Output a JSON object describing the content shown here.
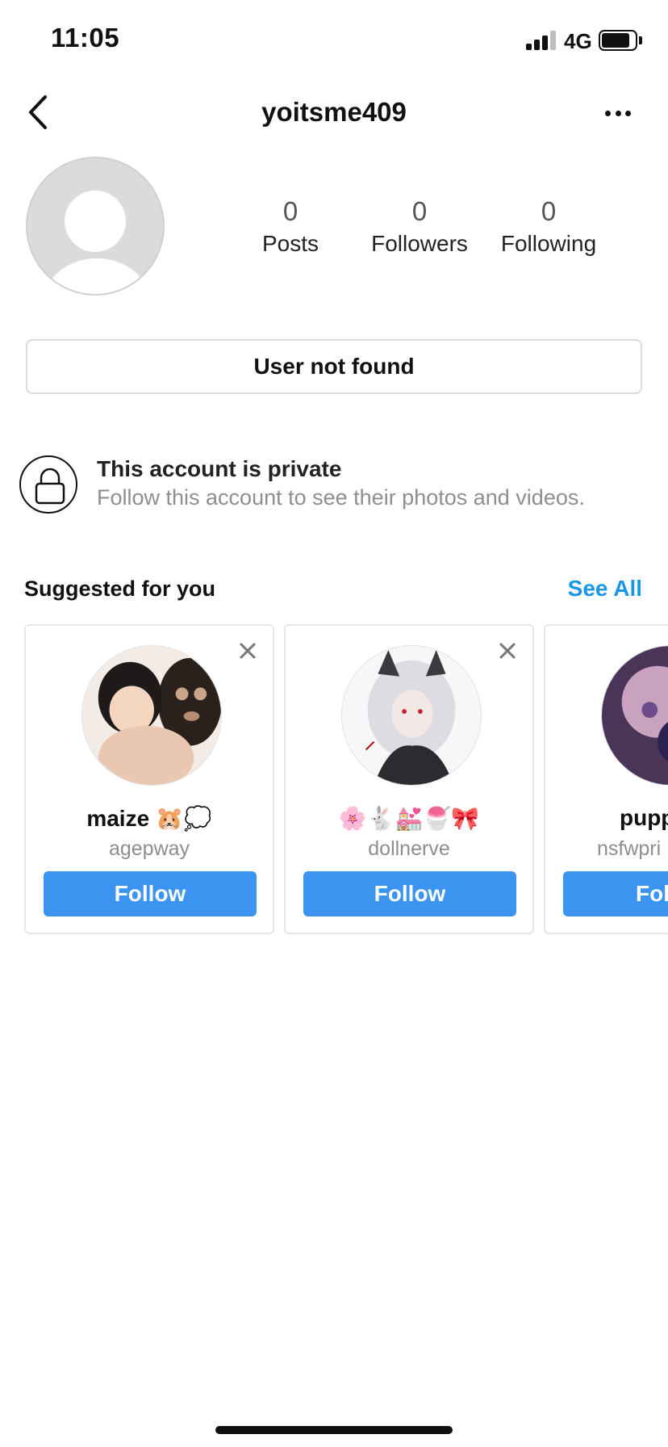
{
  "status_bar": {
    "time": "11:05",
    "network": "4G"
  },
  "header": {
    "username": "yoitsme409"
  },
  "profile": {
    "stats": [
      {
        "count": "0",
        "label": "Posts"
      },
      {
        "count": "0",
        "label": "Followers"
      },
      {
        "count": "0",
        "label": "Following"
      }
    ],
    "not_found_label": "User not found"
  },
  "private_notice": {
    "title": "This account is private",
    "subtitle": "Follow this account to see their photos and videos."
  },
  "suggested": {
    "title": "Suggested for you",
    "see_all_label": "See All",
    "cards": [
      {
        "name": "maize 🐹💭",
        "handle": "agepway",
        "follow_label": "Follow",
        "avatar_colors": [
          "#e9c7b0",
          "#2a211d"
        ]
      },
      {
        "name": "🌸🐇💒🍧🎀",
        "handle": "dollnerve",
        "follow_label": "Follow",
        "avatar_colors": [
          "#e8e8ec",
          "#2b2b30"
        ]
      },
      {
        "name": "pupp",
        "handle": "nsfwpri",
        "follow_label": "Fol",
        "avatar_colors": [
          "#4a3458",
          "#c9a2c0"
        ]
      }
    ]
  },
  "colors": {
    "accent": "#3b94ef",
    "link": "#1a95e8",
    "muted": "#8e8e8e"
  }
}
